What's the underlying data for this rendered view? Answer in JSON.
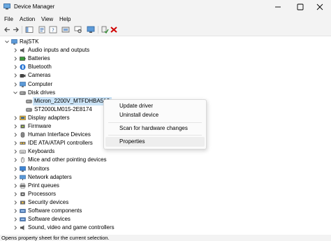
{
  "window": {
    "title": "Device Manager"
  },
  "menu": [
    "File",
    "Action",
    "View",
    "Help"
  ],
  "toolbar": [
    "back",
    "forward",
    "show-hide",
    "properties",
    "help",
    "update-driver",
    "scan-hardware",
    "enable-device",
    "uninstall-device"
  ],
  "tree": {
    "root": "RajSTK",
    "categories": [
      {
        "label": "Audio inputs and outputs",
        "icon": "speaker-icon",
        "expanded": false
      },
      {
        "label": "Batteries",
        "icon": "battery-icon",
        "expanded": false
      },
      {
        "label": "Bluetooth",
        "icon": "bluetooth-icon",
        "expanded": false
      },
      {
        "label": "Cameras",
        "icon": "camera-icon",
        "expanded": false
      },
      {
        "label": "Computer",
        "icon": "computer-icon",
        "expanded": false
      },
      {
        "label": "Disk drives",
        "icon": "disk-icon",
        "expanded": true,
        "children": [
          {
            "label": "Micron_2200V_MTFDHBA512",
            "selected": true
          },
          {
            "label": "ST2000LM015-2E8174",
            "selected": false
          }
        ]
      },
      {
        "label": "Display adapters",
        "icon": "display-icon",
        "expanded": false
      },
      {
        "label": "Firmware",
        "icon": "chip-icon",
        "expanded": false
      },
      {
        "label": "Human Interface Devices",
        "icon": "hid-icon",
        "expanded": false
      },
      {
        "label": "IDE ATA/ATAPI controllers",
        "icon": "controller-icon",
        "expanded": false
      },
      {
        "label": "Keyboards",
        "icon": "keyboard-icon",
        "expanded": false
      },
      {
        "label": "Mice and other pointing devices",
        "icon": "mouse-icon",
        "expanded": false
      },
      {
        "label": "Monitors",
        "icon": "monitor-icon",
        "expanded": false
      },
      {
        "label": "Network adapters",
        "icon": "network-icon",
        "expanded": false
      },
      {
        "label": "Print queues",
        "icon": "printer-icon",
        "expanded": false
      },
      {
        "label": "Processors",
        "icon": "processor-icon",
        "expanded": false
      },
      {
        "label": "Security devices",
        "icon": "security-icon",
        "expanded": false
      },
      {
        "label": "Software components",
        "icon": "component-icon",
        "expanded": false
      },
      {
        "label": "Software devices",
        "icon": "component-icon",
        "expanded": false
      },
      {
        "label": "Sound, video and game controllers",
        "icon": "speaker-icon",
        "expanded": false
      }
    ]
  },
  "context_menu": {
    "items": [
      "Update driver",
      "Uninstall device",
      "Scan for hardware changes",
      "Properties"
    ],
    "highlighted": "Properties"
  },
  "status": "Opens property sheet for the current selection.",
  "colors": {
    "chrome": "#f3f3f3",
    "selection": "#cce4f7",
    "delete": "#d00000",
    "accent": "#0067c0"
  }
}
